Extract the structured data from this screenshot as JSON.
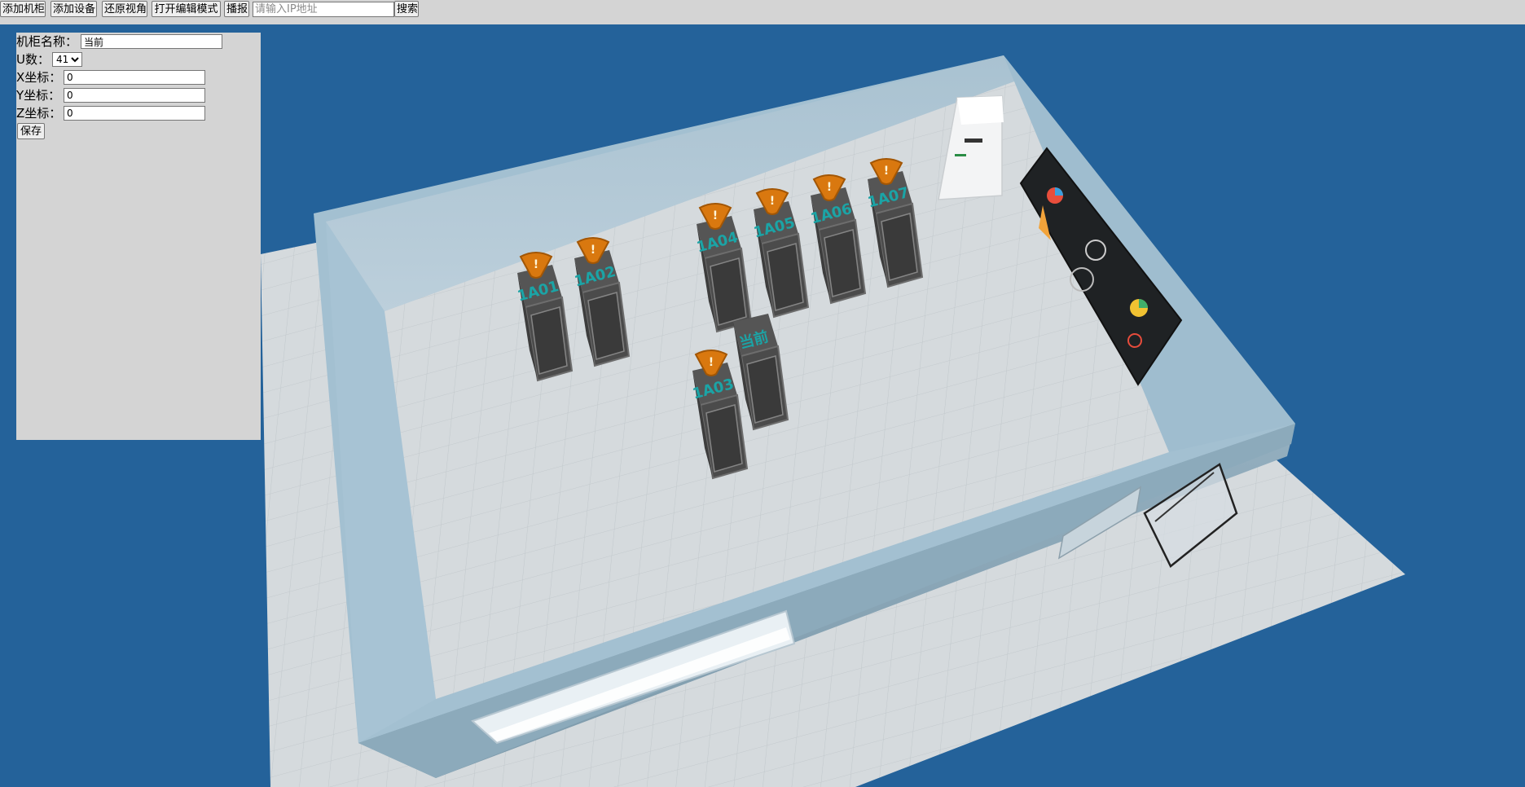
{
  "toolbar": {
    "add_cabinet": "添加机柜",
    "add_device": "添加设备",
    "reset_view": "还原视角",
    "edit_mode": "打开编辑模式",
    "broadcast": "播报",
    "ip_placeholder": "请输入IP地址",
    "search": "搜索"
  },
  "panel": {
    "name_label": "机柜名称：",
    "name_value": "当前",
    "u_label": "U数：",
    "u_value": "41",
    "x_label": "X坐标：",
    "x_value": "0",
    "y_label": "Y坐标：",
    "y_value": "0",
    "z_label": "Z坐标：",
    "z_value": "0",
    "save": "保存"
  },
  "scene": {
    "cabinets": [
      {
        "label": "1A01",
        "alert": true
      },
      {
        "label": "1A02",
        "alert": true
      },
      {
        "label": "1A04",
        "alert": true
      },
      {
        "label": "1A05",
        "alert": true
      },
      {
        "label": "1A06",
        "alert": true
      },
      {
        "label": "1A07",
        "alert": true
      },
      {
        "label": "当前",
        "alert": false
      },
      {
        "label": "1A03",
        "alert": true
      }
    ],
    "alert_glyph": "!",
    "colors": {
      "background": "#24629a",
      "wall": "#a6c4d6",
      "floor": "#d3d8dc",
      "cabinet": "#4b4b4b",
      "cabinet_label": "#1ba4a6",
      "alert": "#d9780f"
    }
  }
}
